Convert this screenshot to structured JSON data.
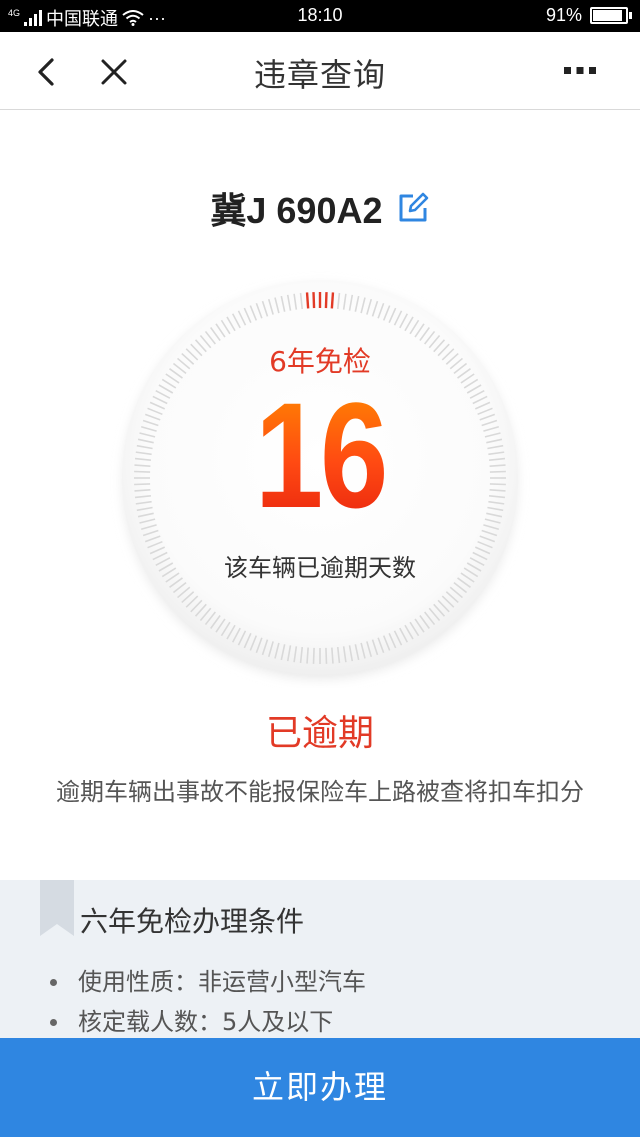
{
  "statusbar": {
    "network_type": "4G",
    "carrier": "中国联通",
    "more": "···",
    "time": "18:10",
    "battery": "91%",
    "battery_level": 0.91
  },
  "navbar": {
    "title": "违章查询",
    "back_icon": "chevron-left-icon",
    "close_icon": "close-icon",
    "more_icon": "more-dots-icon"
  },
  "vehicle": {
    "plate": "冀J 690A2",
    "edit_icon": "edit-icon"
  },
  "dial": {
    "label": "6年免检",
    "days": "16",
    "sub": "该车辆已逾期天数"
  },
  "status": {
    "title": "已逾期",
    "description": "逾期车辆出事故不能报保险车上路被查将扣车扣分"
  },
  "conditions": {
    "title": "六年免检办理条件",
    "items": [
      {
        "text": "使用性质：非运营小型汽车"
      },
      {
        "text": "核定载人数：5人及以下"
      }
    ]
  },
  "cta": {
    "label": "立即办理"
  },
  "colors": {
    "accent_red": "#e23a26",
    "number_orange": "#ff5a10",
    "cta_blue": "#2f86e1",
    "edit_blue": "#2f86e1",
    "panel_bg": "#edf1f5"
  }
}
